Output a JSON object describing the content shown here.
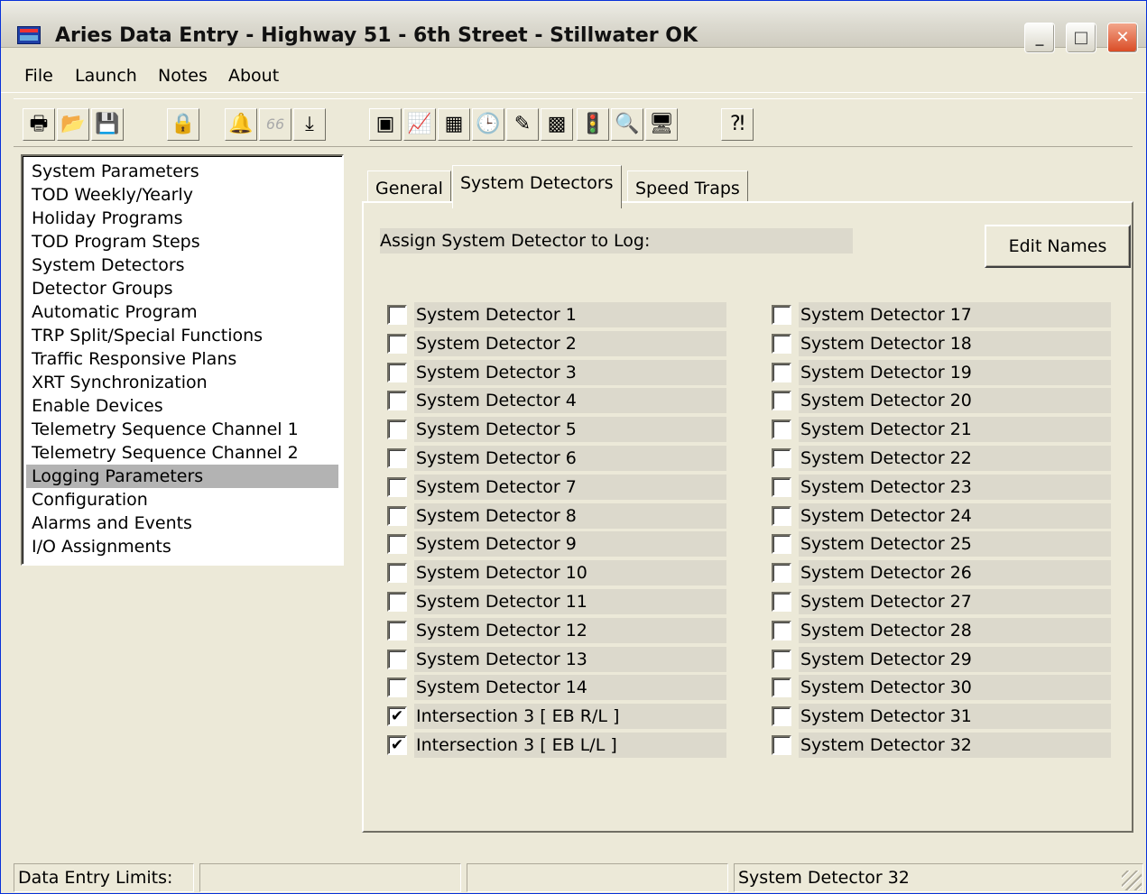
{
  "window": {
    "title": "Aries Data Entry - Highway 51 - 6th Street - Stillwater OK",
    "minimize": "_",
    "maximize": "□",
    "close": "✕"
  },
  "menu": [
    "File",
    "Launch",
    "Notes",
    "About"
  ],
  "toolbar": {
    "buttons": [
      {
        "name": "print-icon",
        "glyph": "🖶"
      },
      {
        "name": "open-folder-icon",
        "glyph": "📂"
      },
      {
        "name": "save-icon",
        "glyph": "💾"
      },
      {
        "name": "lock-icon",
        "glyph": "🔒"
      },
      {
        "name": "bell-icon",
        "glyph": "🔔"
      },
      {
        "name": "disabled-tool-icon",
        "glyph": "66"
      },
      {
        "name": "download-icon",
        "glyph": "⤓"
      },
      {
        "name": "screen-icon",
        "glyph": "▣"
      },
      {
        "name": "chart-icon",
        "glyph": "📈"
      },
      {
        "name": "grid-icon",
        "glyph": "▦"
      },
      {
        "name": "clock-icon",
        "glyph": "🕒"
      },
      {
        "name": "pencil-icon",
        "glyph": "✎"
      },
      {
        "name": "matrix-icon",
        "glyph": "▩"
      },
      {
        "name": "traffic-light-icon",
        "glyph": "🚦"
      },
      {
        "name": "search-icon",
        "glyph": "🔍"
      },
      {
        "name": "monitor-icon",
        "glyph": "🖥"
      },
      {
        "name": "help-icon",
        "glyph": "⁈"
      }
    ]
  },
  "nav": {
    "items": [
      "System Parameters",
      "TOD Weekly/Yearly",
      "Holiday Programs",
      "TOD Program Steps",
      "System Detectors",
      "Detector Groups",
      "Automatic Program",
      "TRP Split/Special Functions",
      "Traffic Responsive Plans",
      "XRT Synchronization",
      "Enable Devices",
      "Telemetry Sequence Channel 1",
      "Telemetry Sequence Channel 2",
      "Logging Parameters",
      "Configuration",
      "Alarms and Events",
      "I/O Assignments"
    ],
    "selected": "Logging Parameters"
  },
  "tabs": {
    "general": "General",
    "system_detectors": "System Detectors",
    "speed_traps": "Speed Traps",
    "active": "System Detectors"
  },
  "panel": {
    "assign_label": "Assign System Detector to Log:",
    "edit_names": "Edit Names",
    "check_mark": "✔",
    "left_column": [
      {
        "label": "System Detector 1",
        "checked": false
      },
      {
        "label": "System Detector 2",
        "checked": false
      },
      {
        "label": "System Detector 3",
        "checked": false
      },
      {
        "label": "System Detector 4",
        "checked": false
      },
      {
        "label": "System Detector 5",
        "checked": false
      },
      {
        "label": "System Detector 6",
        "checked": false
      },
      {
        "label": "System Detector 7",
        "checked": false
      },
      {
        "label": "System Detector 8",
        "checked": false
      },
      {
        "label": "System Detector 9",
        "checked": false
      },
      {
        "label": "System Detector 10",
        "checked": false
      },
      {
        "label": "System Detector 11",
        "checked": false
      },
      {
        "label": "System Detector 12",
        "checked": false
      },
      {
        "label": "System Detector 13",
        "checked": false
      },
      {
        "label": "System Detector 14",
        "checked": false
      },
      {
        "label": "Intersection 3 [ EB R/L ]",
        "checked": true
      },
      {
        "label": "Intersection 3 [ EB L/L ]",
        "checked": true
      }
    ],
    "right_column": [
      {
        "label": "System Detector 17",
        "checked": false
      },
      {
        "label": "System Detector 18",
        "checked": false
      },
      {
        "label": "System Detector 19",
        "checked": false
      },
      {
        "label": "System Detector 20",
        "checked": false
      },
      {
        "label": "System Detector 21",
        "checked": false
      },
      {
        "label": "System Detector 22",
        "checked": false
      },
      {
        "label": "System Detector 23",
        "checked": false
      },
      {
        "label": "System Detector 24",
        "checked": false
      },
      {
        "label": "System Detector 25",
        "checked": false
      },
      {
        "label": "System Detector 26",
        "checked": false
      },
      {
        "label": "System Detector 27",
        "checked": false
      },
      {
        "label": "System Detector 28",
        "checked": false
      },
      {
        "label": "System Detector 29",
        "checked": false
      },
      {
        "label": "System Detector 30",
        "checked": false
      },
      {
        "label": "System Detector 31",
        "checked": false
      },
      {
        "label": "System Detector 32",
        "checked": false
      }
    ]
  },
  "status": {
    "limits_label": "Data Entry Limits:",
    "cell2": "",
    "cell3": "",
    "cell4": "System Detector 32"
  }
}
